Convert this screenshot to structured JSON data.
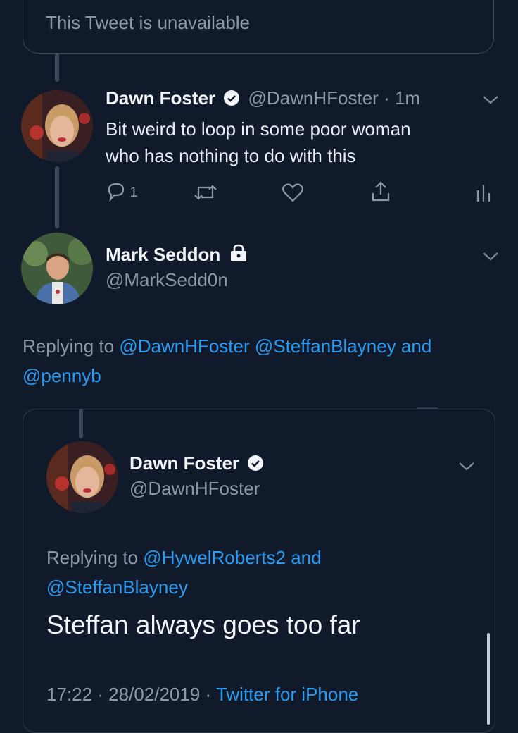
{
  "unavailable_text": "This Tweet is unavailable",
  "tweet1": {
    "name": "Dawn Foster",
    "handle": "@DawnHFoster",
    "time": "· 1m",
    "text_line1": "Bit weird to loop in some poor woman",
    "text_line2": "who has nothing to do with this",
    "reply_count": "1"
  },
  "tweet2": {
    "name": "Mark Seddon",
    "handle": "@MarkSedd0n",
    "replying_prefix": "Replying to",
    "replying_handles_line1": "@DawnHFoster @SteffanBlayney and",
    "replying_handles_line2": "@pennyb"
  },
  "quoted": {
    "name": "Dawn Foster",
    "handle": "@DawnHFoster",
    "replying_prefix": "Replying to",
    "replying_line1": "@HywelRoberts2 and",
    "replying_line2": "@SteffanBlayney",
    "text": "Steffan always goes too far",
    "timestamp": "17:22 · 28/02/2019 ·",
    "source": "Twitter for iPhone"
  },
  "icons": [
    "verified-badge-icon",
    "lock-icon",
    "chevron-down-icon",
    "reply-icon",
    "retweet-icon",
    "like-icon",
    "share-icon",
    "analytics-icon"
  ]
}
